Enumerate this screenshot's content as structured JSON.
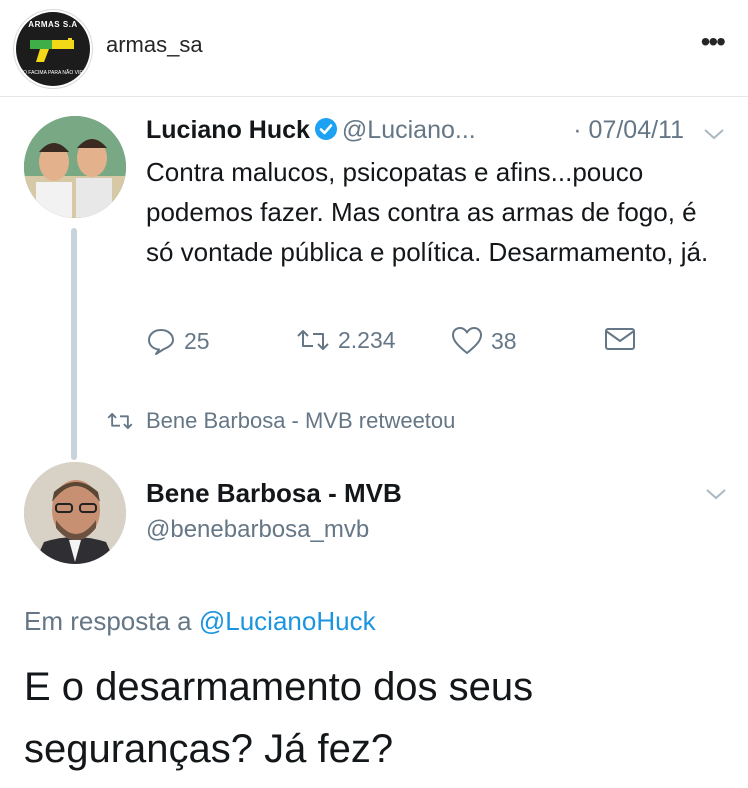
{
  "header": {
    "username": "armas_sa",
    "avatar_logo_text": "ARMAS S.A",
    "avatar_logo_subtext": "NÃO FACIMA PARA NÃO VIRAR",
    "more_icon": "more-horizontal-icon"
  },
  "tweet1": {
    "name": "Luciano Huck",
    "handle": "@Luciano...",
    "date": "· 07/04/11",
    "text": "Contra malucos, psicopatas e afins...pouco podemos fazer. Mas contra as armas de fogo, é só vontade pública e política. Desarmamento, já.",
    "replies": "25",
    "retweets": "2.234",
    "likes": "38"
  },
  "retweet_bar": {
    "label": "Bene Barbosa - MVB retweetou"
  },
  "tweet2": {
    "name": "Bene Barbosa - MVB",
    "handle": "@benebarbosa_mvb",
    "reply_prefix": "Em resposta a ",
    "reply_mention": "@LucianoHuck",
    "text": "E o desarmamento dos seus seguranças? Já fez?"
  },
  "colors": {
    "verified": "#1da1f2",
    "muted": "#657786",
    "link": "#1b95e0",
    "thread_line": "#c8d3dc"
  }
}
